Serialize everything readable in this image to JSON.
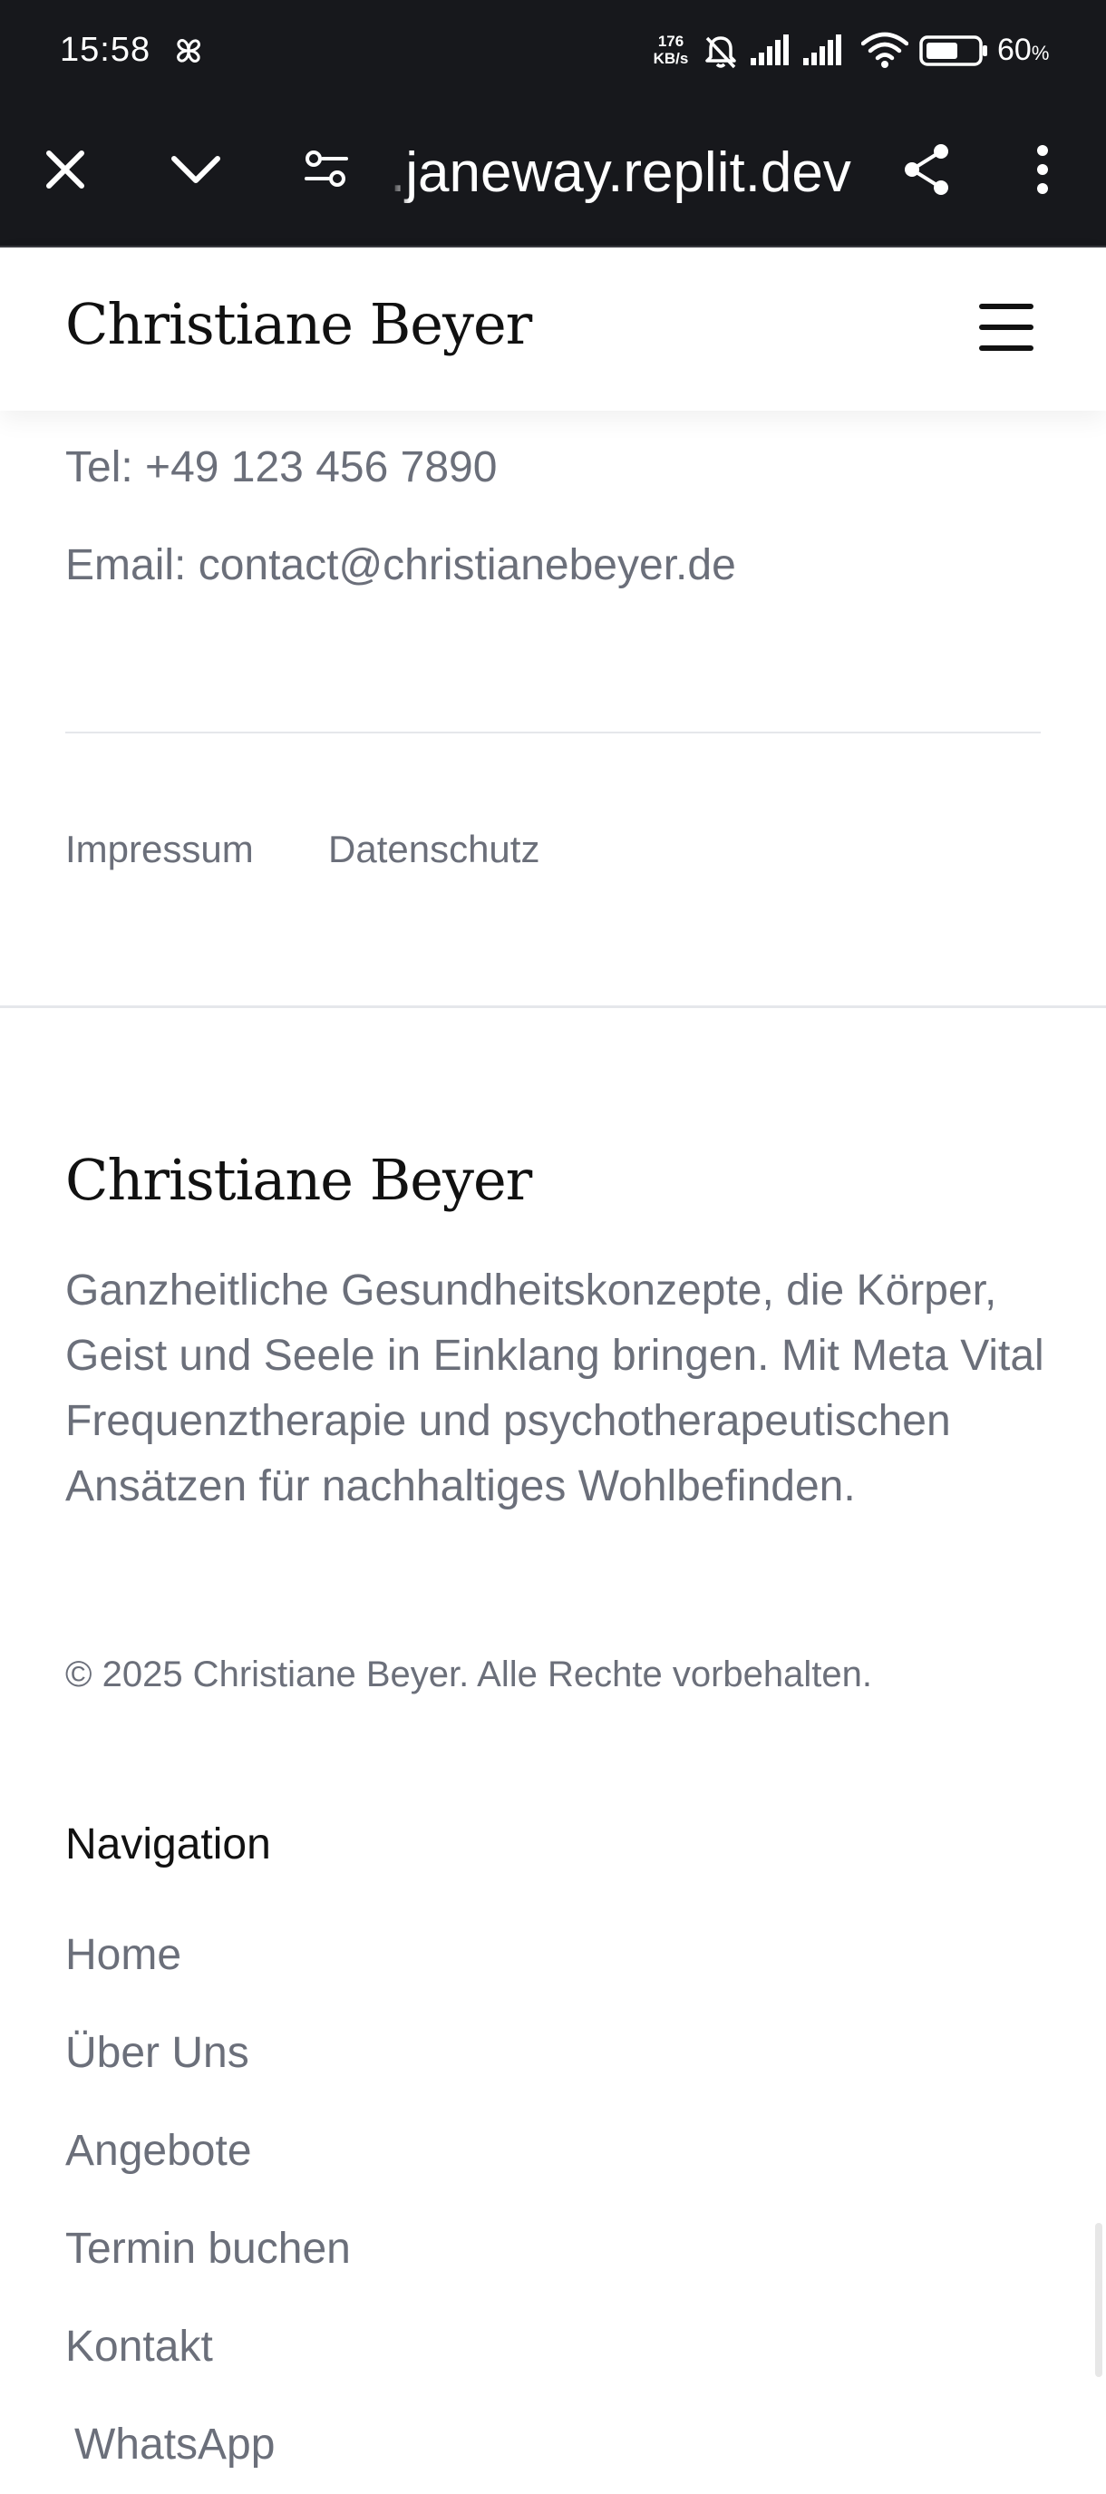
{
  "status_bar": {
    "time": "15:58",
    "net_speed_value": "176",
    "net_speed_unit": "KB/s",
    "battery_percent": "60",
    "battery_unit": "%"
  },
  "browser": {
    "url": ".janeway.replit.dev"
  },
  "header": {
    "brand": "Christiane Beyer"
  },
  "contact": {
    "phone": "Tel: +49 123 456 7890",
    "email": "Email: contact@christianebeyer.de"
  },
  "legal_links": [
    {
      "label": "Impressum"
    },
    {
      "label": "Datenschutz"
    }
  ],
  "footer": {
    "brand": "Christiane Beyer",
    "description": "Ganzheitliche Gesundheitskonzepte, die Körper, Geist und Seele in Einklang bringen. Mit Meta Vital Frequenztherapie und psychotherapeutischen Ansätzen für nachhaltiges Wohlbefinden.",
    "copyright": "© 2025 Christiane Beyer. Alle Rechte vorbehalten.",
    "nav_heading": "Navigation",
    "nav_items": [
      {
        "label": "Home"
      },
      {
        "label": "Über Uns"
      },
      {
        "label": "Angebote"
      },
      {
        "label": "Termin buchen"
      },
      {
        "label": "Kontakt"
      },
      {
        "label": "WhatsApp"
      }
    ]
  },
  "colors": {
    "chrome_bg": "#17181c",
    "text_primary": "#111111",
    "text_muted": "#6b6f7a",
    "divider": "#e5e7eb"
  }
}
